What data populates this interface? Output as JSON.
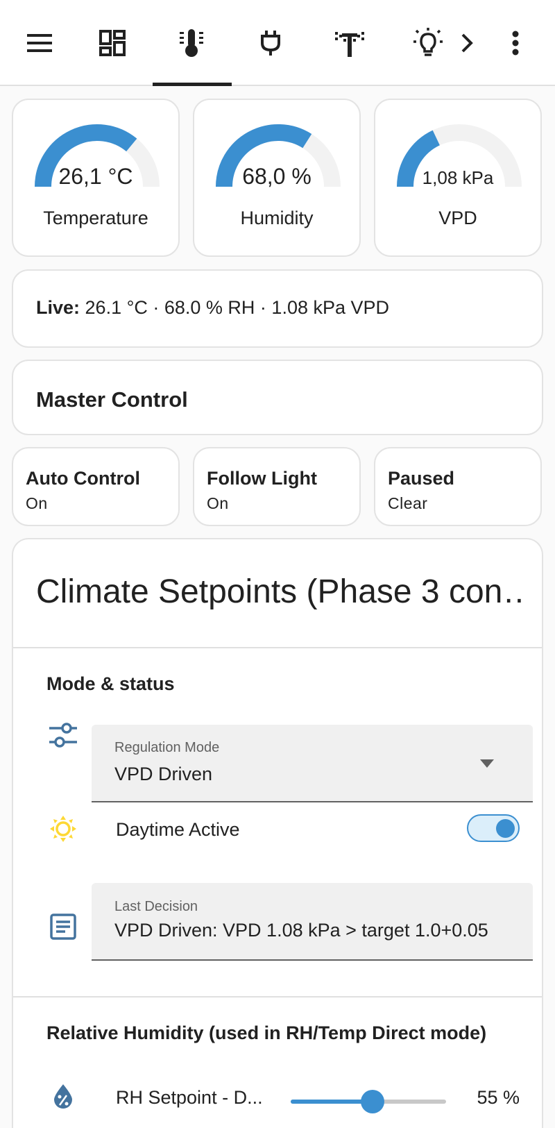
{
  "topbar": {
    "icons": [
      "menu-icon",
      "dashboard-icon",
      "thermometer-icon",
      "power-plug-icon",
      "sprinkler-icon",
      "lightbulb-icon",
      "chevron-right-icon",
      "more-vert-icon"
    ],
    "active_tab": "thermometer-icon"
  },
  "gauges": [
    {
      "value": "26,1 °C",
      "label": "Temperature",
      "level": 0.72,
      "color": "#3b8fd0"
    },
    {
      "value": "68,0 %",
      "label": "Humidity",
      "level": 0.68,
      "color": "#3b8fd0"
    },
    {
      "value": "1,08 kPa",
      "label": "VPD",
      "level": 0.36,
      "color": "#3b8fd0"
    }
  ],
  "live": {
    "prefix": "Live:",
    "text": " 26.1 °C · 68.0 % RH · 1.08 kPa VPD"
  },
  "master_control": {
    "title": "Master Control"
  },
  "toggles": [
    {
      "name": "Auto Control",
      "state": "On"
    },
    {
      "name": "Follow Light",
      "state": "On"
    },
    {
      "name": "Paused",
      "state": "Clear"
    }
  ],
  "setpoints": {
    "title": "Climate Setpoints (Phase 3 con…",
    "mode_section": "Mode & status",
    "regulation_mode": {
      "label": "Regulation Mode",
      "value": "VPD Driven"
    },
    "daytime": {
      "label": "Daytime Active",
      "on": true
    },
    "last_decision": {
      "label": "Last Decision",
      "value": "VPD Driven: VPD 1.08 kPa > target 1.0+0.05"
    },
    "rh_section": "Relative Humidity (used in RH/Temp Direct mode)",
    "rh_setpoint": {
      "label": "RH Setpoint - D...",
      "value_text": "55 %",
      "level": 0.5
    }
  },
  "colors": {
    "accent": "#3b8fd0",
    "icon_blue": "#44739e",
    "sun_yellow": "#fdd835"
  }
}
